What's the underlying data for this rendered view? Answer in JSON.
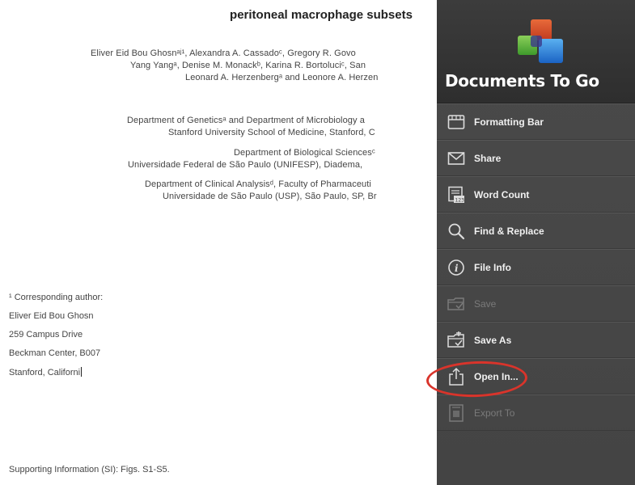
{
  "document": {
    "title": "peritoneal macrophage subsets",
    "authors": [
      "Eliver Eid Bou Ghosnᵃʲ¹, Alexandra A. Cassadoᶜ, Gregory R. Govo",
      "Yang Yangᵃ, Denise M. Monackᵇ, Karina R. Bortoluciᶜ, San",
      "Leonard A. Herzenbergᵃ and Leonore A. Herzen"
    ],
    "affiliations": [
      "Department of Geneticsᵃ and Department of Microbiology a",
      "Stanford University School of Medicine, Stanford, C",
      "Department of Biological Sciencesᶜ",
      "Universidade Federal de São Paulo (UNIFESP), Diadema,",
      "Department of Clinical Analysisᵈ, Faculty of Pharmaceuti",
      "Universidade de São Paulo (USP), São Paulo, SP, Br"
    ],
    "corresponding": [
      "¹ Corresponding author:",
      "Eliver Eid Bou Ghosn",
      "259 Campus Drive",
      "Beckman Center, B007",
      "Stanford, Californi"
    ],
    "supporting": "Supporting Information (SI): Figs. S1-S5."
  },
  "menu": {
    "brand": "Documents To Go",
    "items": [
      {
        "label": "Formatting Bar",
        "icon": "formatting-bar-icon",
        "enabled": true
      },
      {
        "label": "Share",
        "icon": "envelope-icon",
        "enabled": true
      },
      {
        "label": "Word Count",
        "icon": "word-count-icon",
        "enabled": true
      },
      {
        "label": "Find & Replace",
        "icon": "magnifier-icon",
        "enabled": true
      },
      {
        "label": "File Info",
        "icon": "info-icon",
        "enabled": true
      },
      {
        "label": "Save",
        "icon": "save-icon",
        "enabled": false
      },
      {
        "label": "Save As",
        "icon": "save-as-icon",
        "enabled": true
      },
      {
        "label": "Open In...",
        "icon": "open-in-icon",
        "enabled": true
      },
      {
        "label": "Export To",
        "icon": "export-icon",
        "enabled": false
      }
    ]
  },
  "colors": {
    "highlight": "#d9342b",
    "panel": "#4a4a4a"
  }
}
